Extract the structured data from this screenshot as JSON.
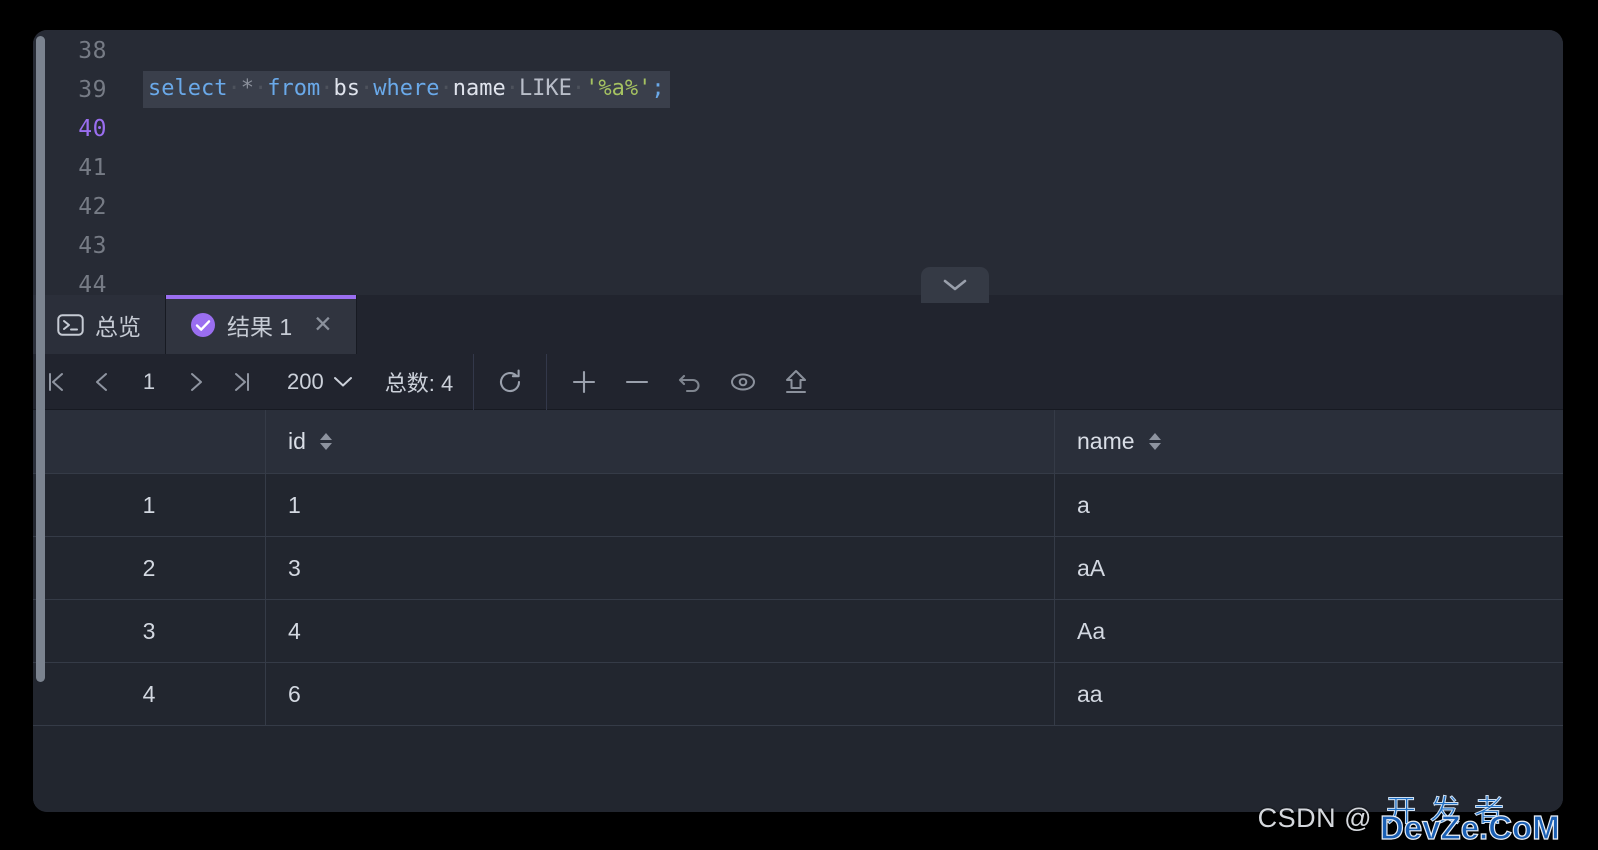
{
  "editor": {
    "line_numbers": [
      "38",
      "39",
      "40",
      "41",
      "42",
      "43",
      "44"
    ],
    "current_line": "40",
    "sql_tokens": [
      {
        "text": "select",
        "type": "kw"
      },
      {
        "text": "·",
        "type": "dot"
      },
      {
        "text": "*",
        "type": "op"
      },
      {
        "text": "·",
        "type": "dot"
      },
      {
        "text": "from",
        "type": "kw"
      },
      {
        "text": "·",
        "type": "dot"
      },
      {
        "text": "bs",
        "type": "id"
      },
      {
        "text": "·",
        "type": "dot"
      },
      {
        "text": "where",
        "type": "kw"
      },
      {
        "text": "·",
        "type": "dot"
      },
      {
        "text": "name",
        "type": "id"
      },
      {
        "text": "·",
        "type": "dot"
      },
      {
        "text": "LIKE",
        "type": "plain"
      },
      {
        "text": "·",
        "type": "dot"
      },
      {
        "text": "'%a%'",
        "type": "str"
      },
      {
        "text": ";",
        "type": "kw"
      }
    ],
    "sql_text": "select * from bs where name LIKE '%a%';",
    "collapse_icon": "chevron-down-icon"
  },
  "tabs": [
    {
      "id": "overview",
      "label": "总览",
      "icon": "terminal-icon",
      "active": false
    },
    {
      "id": "result-1",
      "label": "结果 1",
      "icon": "check-circle-icon",
      "active": true,
      "close_label": "✕"
    }
  ],
  "toolbar": {
    "first_page_icon": "first-page-icon",
    "prev_page_icon": "prev-page-icon",
    "page_value": "1",
    "next_page_icon": "next-page-icon",
    "last_page_icon": "last-page-icon",
    "page_size": "200",
    "page_size_caret": "chevron-down-icon",
    "total_label": "总数:",
    "total_value": "4",
    "actions": [
      {
        "name": "refresh-icon"
      },
      {
        "name": "add-row-icon"
      },
      {
        "name": "delete-row-icon"
      },
      {
        "name": "undo-icon"
      },
      {
        "name": "preview-icon"
      },
      {
        "name": "commit-icon"
      }
    ]
  },
  "grid": {
    "columns": [
      {
        "key": "rownum",
        "label": ""
      },
      {
        "key": "id",
        "label": "id",
        "sortable": true
      },
      {
        "key": "name",
        "label": "name",
        "sortable": true
      }
    ],
    "rows": [
      {
        "rownum": "1",
        "id": "1",
        "name": "a"
      },
      {
        "rownum": "2",
        "id": "3",
        "name": "aA"
      },
      {
        "rownum": "3",
        "id": "4",
        "name": "Aa"
      },
      {
        "rownum": "4",
        "id": "6",
        "name": "aa"
      }
    ]
  },
  "watermark": {
    "csdn": "CSDN @",
    "cn": "开发者",
    "en": "DevZe.CoM"
  },
  "colors": {
    "accent": "#9a6ef0",
    "panel_bg": "#242832",
    "editor_bg": "#272b35",
    "toolbar_bg": "#21242e",
    "grid_bg": "#22262f",
    "header_bg": "#2a2f3a",
    "keyword": "#6aa9e9",
    "string": "#a5c261",
    "text": "#d3d8e1"
  }
}
